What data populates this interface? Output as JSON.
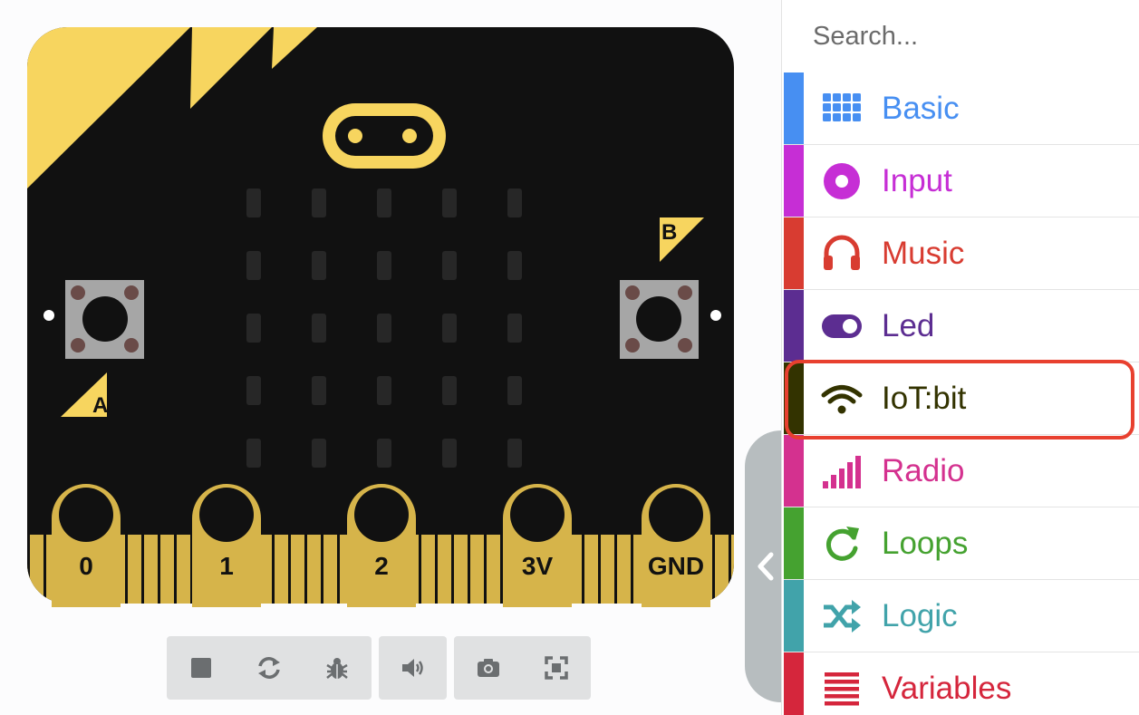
{
  "board": {
    "button_a": "A",
    "button_b": "B",
    "pins": [
      "0",
      "1",
      "2",
      "3V",
      "GND"
    ],
    "colors": {
      "pcb": "#111111",
      "gold": "#f7d55f",
      "pad": "#d6b44a",
      "button": "#a6a6a6"
    }
  },
  "sim_toolbar": {
    "buttons": [
      {
        "name": "stop-icon"
      },
      {
        "name": "restart-icon"
      },
      {
        "name": "debug-icon"
      },
      {
        "name": "sound-icon"
      },
      {
        "name": "screenshot-icon"
      },
      {
        "name": "fullscreen-icon"
      }
    ]
  },
  "toolbox": {
    "search": {
      "placeholder": "Search..."
    },
    "categories": [
      {
        "label": "Basic",
        "color": "#478ff2",
        "icon": "grid-icon"
      },
      {
        "label": "Input",
        "color": "#c62ed5",
        "icon": "circle-dot-icon"
      },
      {
        "label": "Music",
        "color": "#d83c31",
        "icon": "headphones-icon"
      },
      {
        "label": "Led",
        "color": "#5c2d91",
        "icon": "toggle-icon"
      },
      {
        "label": "IoT:bit",
        "color": "#333300",
        "icon": "wifi-icon",
        "highlighted": true
      },
      {
        "label": "Radio",
        "color": "#d4318f",
        "icon": "signal-bars-icon"
      },
      {
        "label": "Loops",
        "color": "#45a230",
        "icon": "refresh-icon"
      },
      {
        "label": "Logic",
        "color": "#41a3aa",
        "icon": "shuffle-icon"
      },
      {
        "label": "Variables",
        "color": "#d5263c",
        "icon": "list-icon"
      }
    ]
  }
}
